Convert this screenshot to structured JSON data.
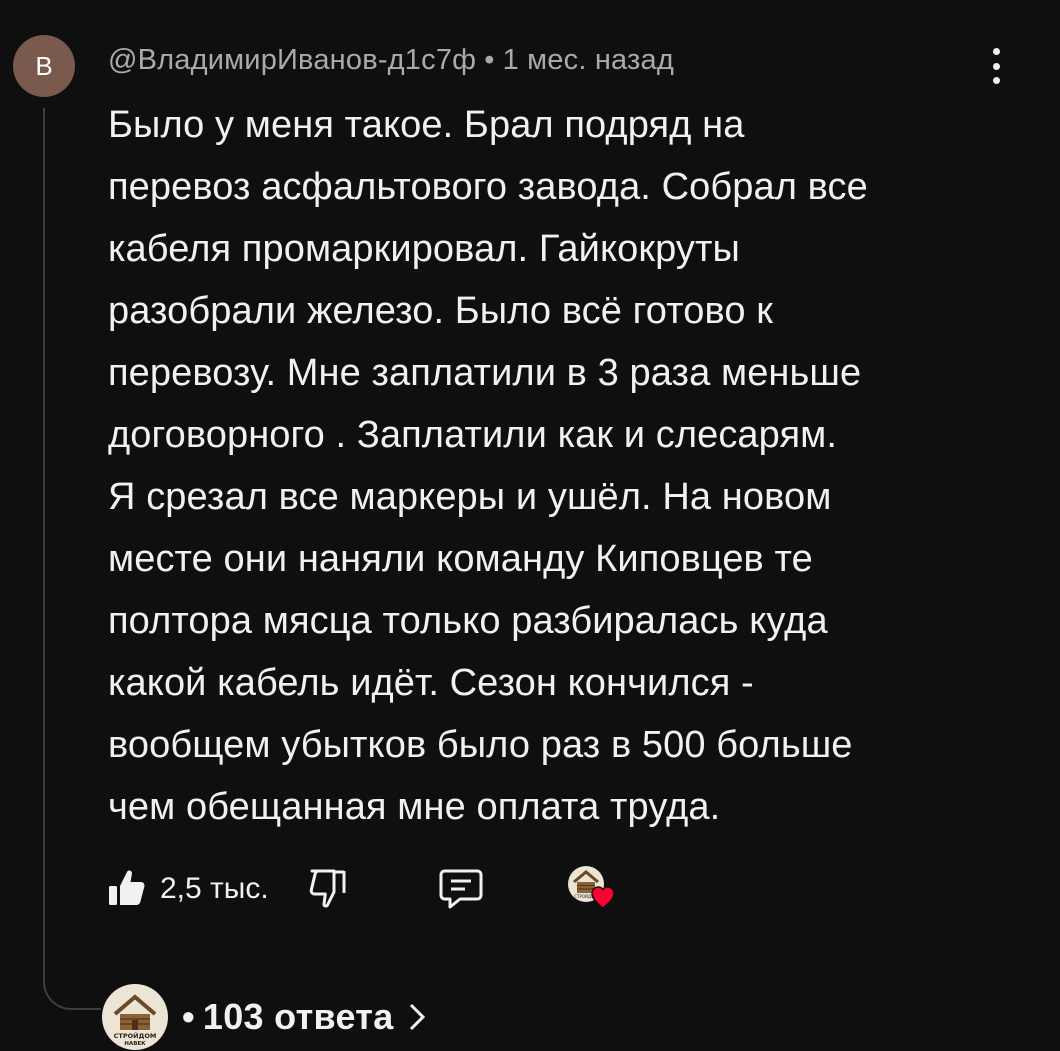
{
  "comment": {
    "avatar_letter": "В",
    "author": "@ВладимирИванов-д1с7ф",
    "separator": "•",
    "time": "1 мес. назад",
    "text": "Было у меня такое. Брал подряд на\nперевоз асфальтового завода. Собрал все\nкабеля промаркировал. Гайкокруты\nразобрали железо. Было всё готово к\nперевозу. Мне заплатили в 3 раза меньше\nдоговорного . Заплатили как и  слесарям.\nЯ  срезал все маркеры и ушёл. На новом\nместе  они наняли команду Киповцев те\nполтора мясца только разбиралась куда\nкакой кабель идёт. Сезон кончился -\nвообщем убытков было раз в 500 больше\nчем обещанная мне оплата труда."
  },
  "actions": {
    "like_count": "2,5 тыс."
  },
  "creator_logo": {
    "line1": "СТРОЙДОМ",
    "line2": "НАВЕК"
  },
  "replies": {
    "dot": "•",
    "label": "103 ответа"
  },
  "colors": {
    "background": "#0f0f0f",
    "text_primary": "#f1f1f1",
    "text_secondary": "#aaaaaa",
    "avatar": "#7a5a4c",
    "heart": "#ff0033"
  },
  "icons": [
    "thumb-up-icon",
    "thumb-down-icon",
    "reply-comment-icon",
    "creator-heart-icon",
    "chevron-right-icon",
    "more-vert-icon"
  ]
}
